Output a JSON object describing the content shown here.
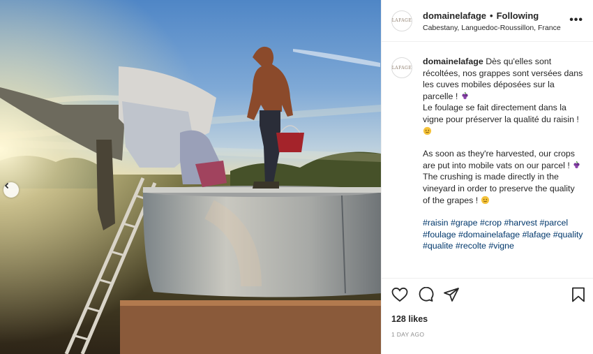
{
  "header": {
    "username": "domainelafage",
    "separator": "•",
    "follow_status": "Following",
    "location": "Cabestany, Languedoc-Roussillon, France",
    "more_icon": "more-options-icon",
    "avatar_text": "LAFAGE"
  },
  "caption": {
    "username": "domainelafage",
    "fr_line1": "Dès qu'elles sont récoltées, nos grappes sont versées dans les cuves mobiles déposées sur la parcelle ! ",
    "fr_line2": "Le foulage se fait directement dans la vigne pour préserver la qualité du raisin ! ",
    "en_line1": "As soon as they're harvested, our crops are put into mobile vats on our parcel ! ",
    "en_line2": "The crushing is made directly in the vineyard in order to preserve the quality of the grapes ! ",
    "hashtags": [
      "#raisin",
      "#grape",
      "#crop",
      "#harvest",
      "#parcel",
      "#foulage",
      "#domainelafage",
      "#lafage",
      "#quality",
      "#qualite",
      "#recolte",
      "#vigne"
    ]
  },
  "actions": {
    "like_icon": "heart-icon",
    "comment_icon": "comment-icon",
    "share_icon": "share-icon",
    "save_icon": "bookmark-icon"
  },
  "likes": "128 likes",
  "time_ago": "1 DAY AGO",
  "colors": {
    "text": "#262626",
    "hashtag": "#00376b",
    "muted": "#8e8e8e",
    "border": "#efefef"
  }
}
